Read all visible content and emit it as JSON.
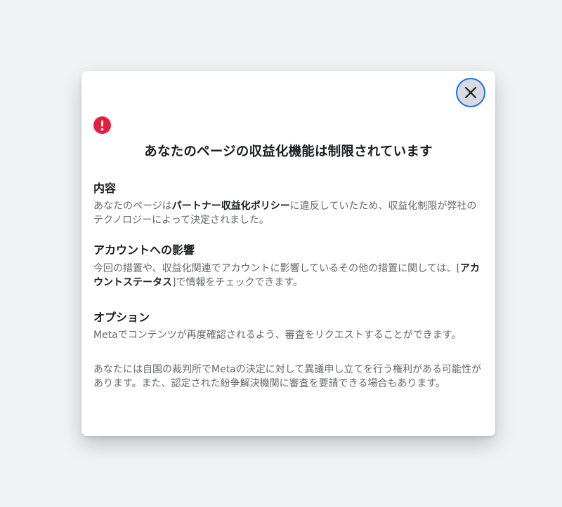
{
  "dialog": {
    "close_label": "閉じる",
    "title": "あなたのページの収益化機能は制限されています",
    "sections": {
      "content": {
        "heading": "内容",
        "text_before": "あなたのページは",
        "policy_link": "パートナー収益化ポリシー",
        "text_after": "に違反していたため、収益化制限が弊社のテクノロジーによって決定されました。"
      },
      "impact": {
        "heading": "アカウントへの影響",
        "text_before": "今回の措置や、収益化関連でアカウントに影響しているその他の措置に関しては、[",
        "status_link": "アカウントステータス",
        "text_after": "]で情報をチェックできます。"
      },
      "options": {
        "heading": "オプション",
        "text1": "Metaでコンテンツが再度確認されるよう、審査をリクエストすることができます。",
        "text2": "あなたには自国の裁判所でMetaの決定に対して異議申し立てを行う権利がある可能性があります。また、認定された紛争解決機関に審査を要請できる場合もあります。"
      }
    }
  },
  "colors": {
    "alert_red": "#e41e3f",
    "focus_blue": "#1b74e4",
    "text_primary": "#1c1e21",
    "text_secondary": "#65676b"
  },
  "icons": {
    "close": "close-icon",
    "alert": "exclamation-circle-icon"
  }
}
